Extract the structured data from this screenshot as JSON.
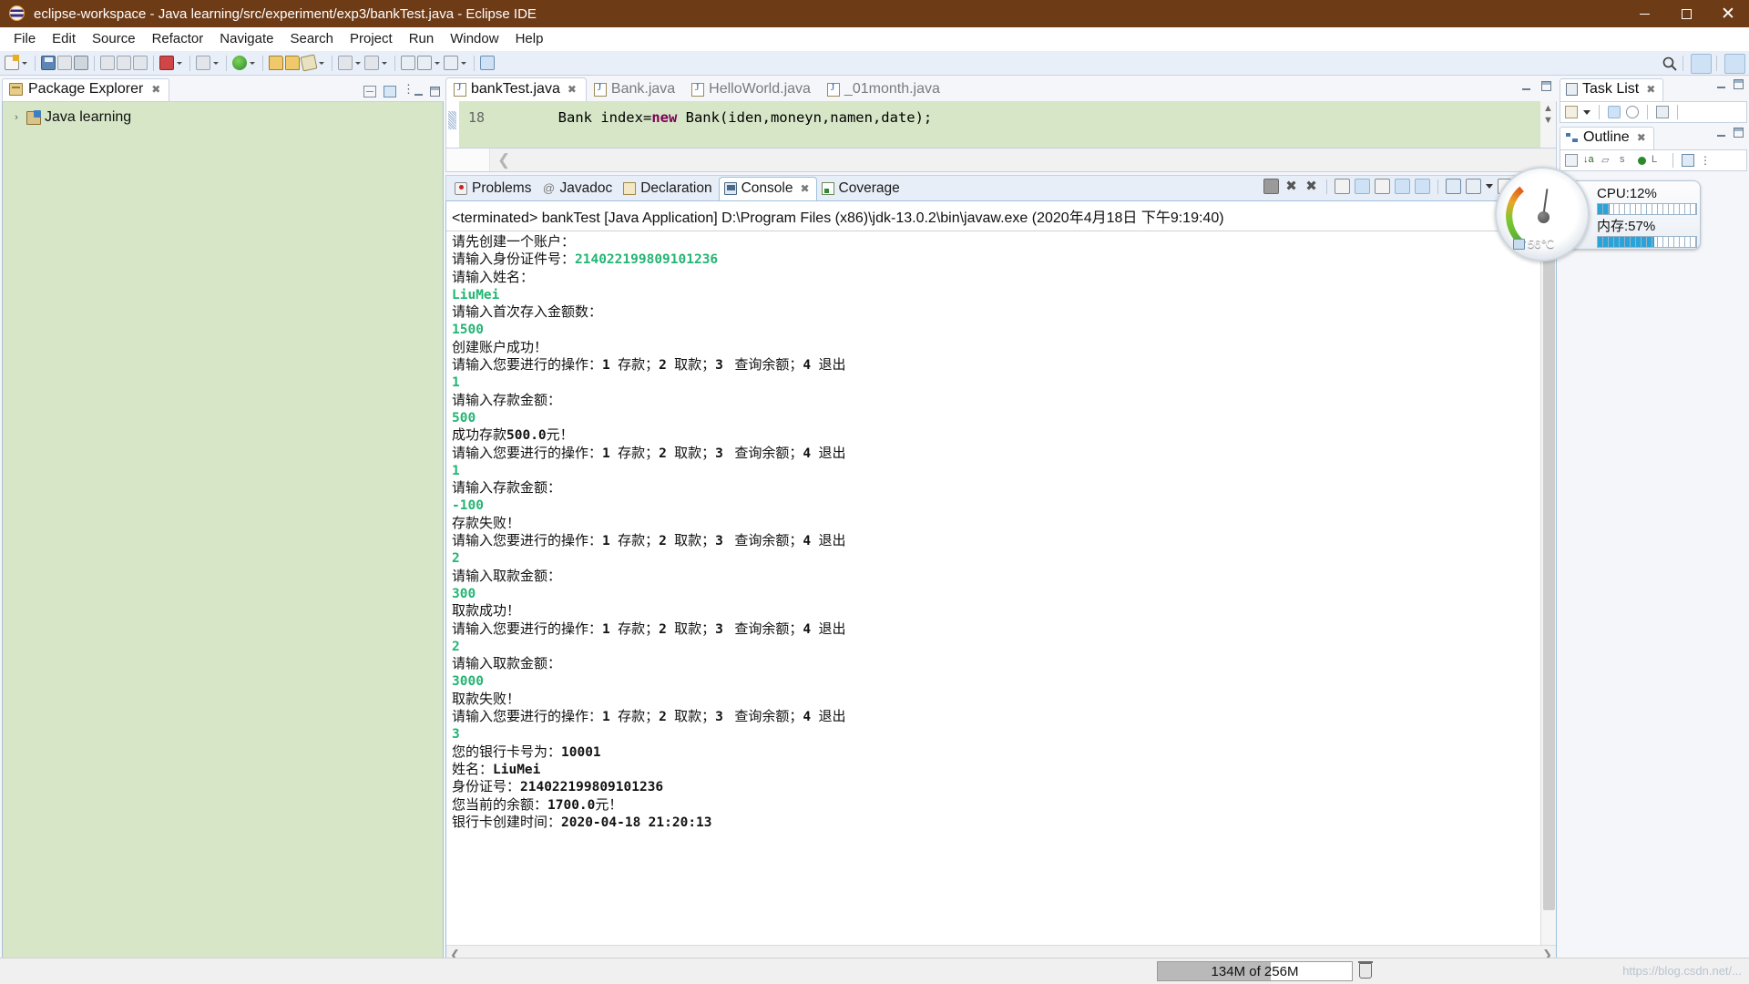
{
  "window": {
    "title": "eclipse-workspace - Java learning/src/experiment/exp3/bankTest.java - Eclipse IDE",
    "app_icon": "eclipse-globe-icon",
    "minimize_label": "Minimize",
    "maximize_label": "Maximize",
    "close_label": "Close"
  },
  "menubar": {
    "items": [
      "File",
      "Edit",
      "Source",
      "Refactor",
      "Navigate",
      "Search",
      "Project",
      "Run",
      "Window",
      "Help"
    ]
  },
  "toolbar": {
    "search_icon": "search-icon",
    "perspective_new_icon": "new-perspective-icon",
    "perspective_java_icon": "java-perspective-icon"
  },
  "package_explorer": {
    "title": "Package Explorer",
    "close_label": "✖",
    "tree": [
      {
        "label": "Java learning",
        "expander": "›",
        "icon": "java-project-icon"
      }
    ],
    "toolbar_icons": [
      "collapse-all-icon",
      "link-with-editor-icon",
      "view-menu-icon"
    ]
  },
  "editor": {
    "tabs": [
      {
        "label": "bankTest.java",
        "active": true,
        "closable": true
      },
      {
        "label": "Bank.java",
        "active": false,
        "closable": false
      },
      {
        "label": "HelloWorld.java",
        "active": false,
        "closable": false
      },
      {
        "label": "_01month.java",
        "active": false,
        "closable": false
      }
    ],
    "close_label": "✖",
    "line_number": "18",
    "code_prefix": "        Bank index=",
    "code_keyword": "new",
    "code_suffix": " Bank(iden,moneyn,namen,date);"
  },
  "console_panel": {
    "tabs": [
      {
        "label": "Problems",
        "icon": "problems-icon",
        "active": false
      },
      {
        "label": "Javadoc",
        "icon": "javadoc-icon",
        "active": false
      },
      {
        "label": "Declaration",
        "icon": "declaration-icon",
        "active": false
      },
      {
        "label": "Console",
        "icon": "console-icon",
        "active": true
      },
      {
        "label": "Coverage",
        "icon": "coverage-icon",
        "active": false
      }
    ],
    "close_label": "✖",
    "header": "<terminated> bankTest [Java Application] D:\\Program Files (x86)\\jdk-13.0.2\\bin\\javaw.exe (2020年4月18日 下午9:19:40)",
    "toolbar_icons": [
      "terminate-icon",
      "remove-launch-icon",
      "remove-all-terminated-icon",
      "clear-console-icon",
      "scroll-lock-icon",
      "word-wrap-icon",
      "show-console-on-output-icon",
      "show-console-on-error-icon",
      "pin-console-icon",
      "display-selected-console-icon",
      "open-console-icon",
      "minimize-icon",
      "maximize-icon"
    ],
    "output_lines": [
      {
        "type": "out",
        "text": "请先创建一个账户："
      },
      {
        "type": "out_in",
        "text": "请输入身份证件号：",
        "value": "214022199809101236"
      },
      {
        "type": "out",
        "text": "请输入姓名："
      },
      {
        "type": "in",
        "text": "LiuMei"
      },
      {
        "type": "out",
        "text": "请输入首次存入金额数："
      },
      {
        "type": "in",
        "text": "1500"
      },
      {
        "type": "out",
        "text": "创建账户成功！"
      },
      {
        "type": "menu",
        "text": "请输入您要进行的操作：1  存款；2  取款；3   查询余额；4  退出"
      },
      {
        "type": "in",
        "text": "1"
      },
      {
        "type": "out",
        "text": "请输入存款金额："
      },
      {
        "type": "in",
        "text": "500"
      },
      {
        "type": "out_num",
        "text": "成功存款500.0元！"
      },
      {
        "type": "menu",
        "text": "请输入您要进行的操作：1  存款；2  取款；3   查询余额；4  退出"
      },
      {
        "type": "in",
        "text": "1"
      },
      {
        "type": "out",
        "text": "请输入存款金额："
      },
      {
        "type": "in",
        "text": "-100"
      },
      {
        "type": "out",
        "text": "存款失败！"
      },
      {
        "type": "menu",
        "text": "请输入您要进行的操作：1  存款；2  取款；3   查询余额；4  退出"
      },
      {
        "type": "in",
        "text": "2"
      },
      {
        "type": "out",
        "text": "请输入取款金额："
      },
      {
        "type": "in",
        "text": "300"
      },
      {
        "type": "out",
        "text": "取款成功！"
      },
      {
        "type": "menu",
        "text": "请输入您要进行的操作：1  存款；2  取款；3   查询余额；4  退出"
      },
      {
        "type": "in",
        "text": "2"
      },
      {
        "type": "out",
        "text": "请输入取款金额："
      },
      {
        "type": "in",
        "text": "3000"
      },
      {
        "type": "out",
        "text": "取款失败！"
      },
      {
        "type": "menu",
        "text": "请输入您要进行的操作：1  存款；2  取款；3   查询余额；4  退出"
      },
      {
        "type": "in",
        "text": "3"
      },
      {
        "type": "out_num",
        "text": "您的银行卡号为：10001"
      },
      {
        "type": "out_num",
        "text": "姓名：LiuMei"
      },
      {
        "type": "out_num",
        "text": "身份证号：214022199809101236"
      },
      {
        "type": "out_num",
        "text": "您当前的余额：1700.0元！"
      },
      {
        "type": "out_num",
        "text": "银行卡创建时间：2020-04-18  21:20:13"
      }
    ]
  },
  "task_list": {
    "title": "Task List",
    "close_label": "✖"
  },
  "outline": {
    "title": "Outline",
    "close_label": "✖"
  },
  "gadget": {
    "cpu_label": "CPU:12%",
    "cpu_percent": 12,
    "memory_label": "内存:57%",
    "memory_percent": 57,
    "temperature": "56℃",
    "accent_color": "#2aa3d8"
  },
  "statusbar": {
    "heap_text": "134M of 256M",
    "heap_percent": 58,
    "trash_icon": "run-gc-icon",
    "watermark": "https://blog.csdn.net/..."
  }
}
